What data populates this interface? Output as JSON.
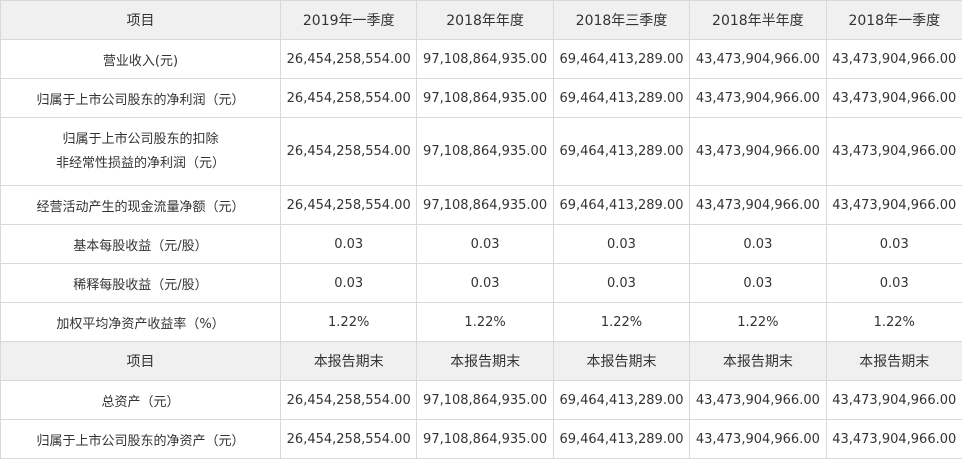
{
  "header": {
    "label": "项目",
    "periods": [
      "2019年一季度",
      "2018年年度",
      "2018年三季度",
      "2018年半年度",
      "2018年一季度"
    ]
  },
  "income_rows": [
    {
      "label": "营业收入(元)",
      "values": [
        "26,454,258,554.00",
        "97,108,864,935.00",
        "69,464,413,289.00",
        "43,473,904,966.00",
        "43,473,904,966.00"
      ]
    },
    {
      "label": "归属于上市公司股东的净利润（元）",
      "values": [
        "26,454,258,554.00",
        "97,108,864,935.00",
        "69,464,413,289.00",
        "43,473,904,966.00",
        "43,473,904,966.00"
      ]
    },
    {
      "label_lines": [
        "归属于上市公司股东的扣除",
        "非经常性损益的净利润（元）"
      ],
      "values": [
        "26,454,258,554.00",
        "97,108,864,935.00",
        "69,464,413,289.00",
        "43,473,904,966.00",
        "43,473,904,966.00"
      ]
    },
    {
      "label": "经营活动产生的现金流量净额（元）",
      "values": [
        "26,454,258,554.00",
        "97,108,864,935.00",
        "69,464,413,289.00",
        "43,473,904,966.00",
        "43,473,904,966.00"
      ]
    },
    {
      "label": "基本每股收益（元/股）",
      "values": [
        "0.03",
        "0.03",
        "0.03",
        "0.03",
        "0.03"
      ]
    },
    {
      "label": "稀释每股收益（元/股）",
      "values": [
        "0.03",
        "0.03",
        "0.03",
        "0.03",
        "0.03"
      ]
    },
    {
      "label": "加权平均净资产收益率（%）",
      "values": [
        "1.22%",
        "1.22%",
        "1.22%",
        "1.22%",
        "1.22%"
      ]
    }
  ],
  "balance_header": {
    "label": "项目",
    "periods": [
      "本报告期末",
      "本报告期末",
      "本报告期末",
      "本报告期末",
      "本报告期末"
    ]
  },
  "balance_rows": [
    {
      "label": "总资产（元）",
      "values": [
        "26,454,258,554.00",
        "97,108,864,935.00",
        "69,464,413,289.00",
        "43,473,904,966.00",
        "43,473,904,966.00"
      ]
    },
    {
      "label": "归属于上市公司股东的净资产（元）",
      "values": [
        "26,454,258,554.00",
        "97,108,864,935.00",
        "69,464,413,289.00",
        "43,473,904,966.00",
        "43,473,904,966.00"
      ]
    }
  ]
}
